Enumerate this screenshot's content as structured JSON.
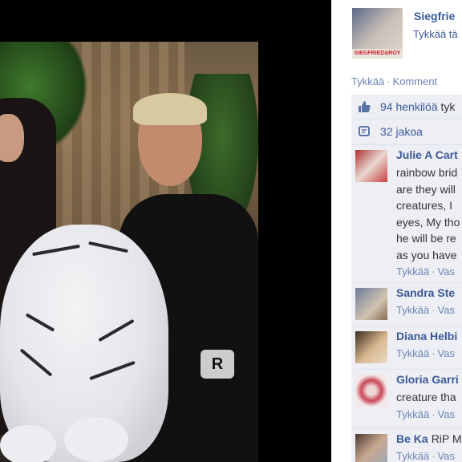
{
  "page": {
    "name": "Siegfrie",
    "like_label": "Tykkää tä",
    "thumb_logo_text": "SIEGFRIED&ROY"
  },
  "actions": {
    "like": "Tykkää",
    "separator": "·",
    "comment": "Komment"
  },
  "stats": {
    "likes_count": "94 henkilöä",
    "likes_rest": "tyk",
    "shares": "32 jakoa",
    "like_icon": "thumbs-up-icon",
    "share_icon": "share-icon"
  },
  "photo": {
    "belt_text": "R"
  },
  "comments": [
    {
      "name": "Julie A Cart",
      "text": "",
      "lines": [
        "rainbow brid",
        "are they will",
        "creatures, I",
        "eyes, My tho",
        "he will be re",
        "as you have"
      ],
      "like": "Tykkää",
      "reply": "Vas"
    },
    {
      "name": "Sandra Ste",
      "text": "",
      "lines": [],
      "like": "Tykkää",
      "reply": "Vas"
    },
    {
      "name": "Diana Helbi",
      "text": "",
      "lines": [],
      "like": "Tykkää",
      "reply": "Vas"
    },
    {
      "name": "Gloria Garri",
      "text": "",
      "lines": [
        "creature tha"
      ],
      "like": "Tykkää",
      "reply": "Vas"
    },
    {
      "name": "Be Ka",
      "text": "RiP M",
      "lines": [],
      "like": "Tykkää",
      "reply": "Vas"
    }
  ],
  "colors": {
    "link": "#3b5998",
    "ufi_bg": "#edeff4",
    "viewer_bg": "#000000"
  }
}
